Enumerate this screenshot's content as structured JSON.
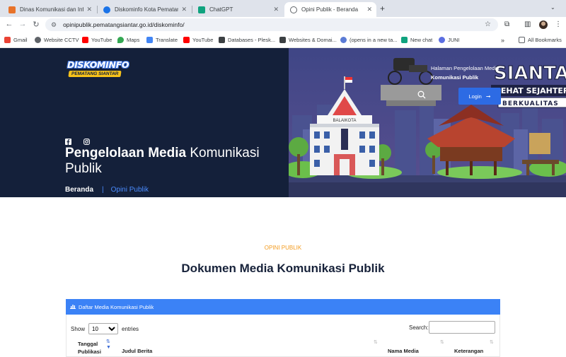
{
  "tabs": [
    {
      "title": "Dinas Komunikasi dan Informatika",
      "color": "#e8732a",
      "active": false
    },
    {
      "title": "Diskominfo Kota Pematangsiantar",
      "color": "#1a73e8",
      "active": false
    },
    {
      "title": "ChatGPT",
      "color": "#10a37f",
      "active": false
    },
    {
      "title": "Opini Publik - Beranda",
      "color": "#5f6368",
      "active": true
    }
  ],
  "url": "opinipublik.pematangsiantar.go.id/diskominfo/",
  "bookmarks": [
    {
      "label": "Gmail",
      "color": "#ea4335"
    },
    {
      "label": "Website CCTV",
      "color": "#5f6368"
    },
    {
      "label": "YouTube",
      "color": "#ff0000"
    },
    {
      "label": "Maps",
      "color": "#34a853"
    },
    {
      "label": "Translate",
      "color": "#4285f4"
    },
    {
      "label": "YouTube",
      "color": "#ff0000"
    },
    {
      "label": "Databases - Plesk...",
      "color": "#3c4043"
    },
    {
      "label": "Websites & Domai...",
      "color": "#3c4043"
    },
    {
      "label": "(opens in a new ta...",
      "color": "#5b7bd5"
    },
    {
      "label": "New chat",
      "color": "#10a37f"
    },
    {
      "label": "JUNI",
      "color": "#5b6ee1"
    }
  ],
  "all_bookmarks": "All Bookmarks",
  "hero": {
    "logo_top": "DISKOMINFO",
    "logo_bottom": "PEMATANG SIANTAR",
    "title_bold": "Pengelolaan Media",
    "title_rest": " Komunikasi Publik",
    "crumb_home": "Beranda",
    "crumb_sep": "|",
    "crumb_current": "Opini Publik",
    "caption_line1": "Halaman Pengelolaan Media",
    "caption_line2": "Komunikasi Publik",
    "login": "Login",
    "banner_word": "SIANTAR",
    "banner_sub1": "SEHAT SEJAHTERA",
    "banner_sub2": "BERKUALITAS",
    "building_sign": "BALAIKOTA"
  },
  "content": {
    "eyebrow": "OPINI PUBLIK",
    "headline": "Dokumen Media Komunikasi Publik",
    "panel_title": "Daftar Media Komunikasi Publik",
    "show_label": "Show",
    "show_value": "10",
    "entries_label": "entries",
    "search_label": "Search:",
    "col_date_1": "Tanggal",
    "col_date_2": "Publikasi",
    "col_title": "Judul Berita",
    "col_media": "Nama Media",
    "col_note": "Keterangan"
  }
}
